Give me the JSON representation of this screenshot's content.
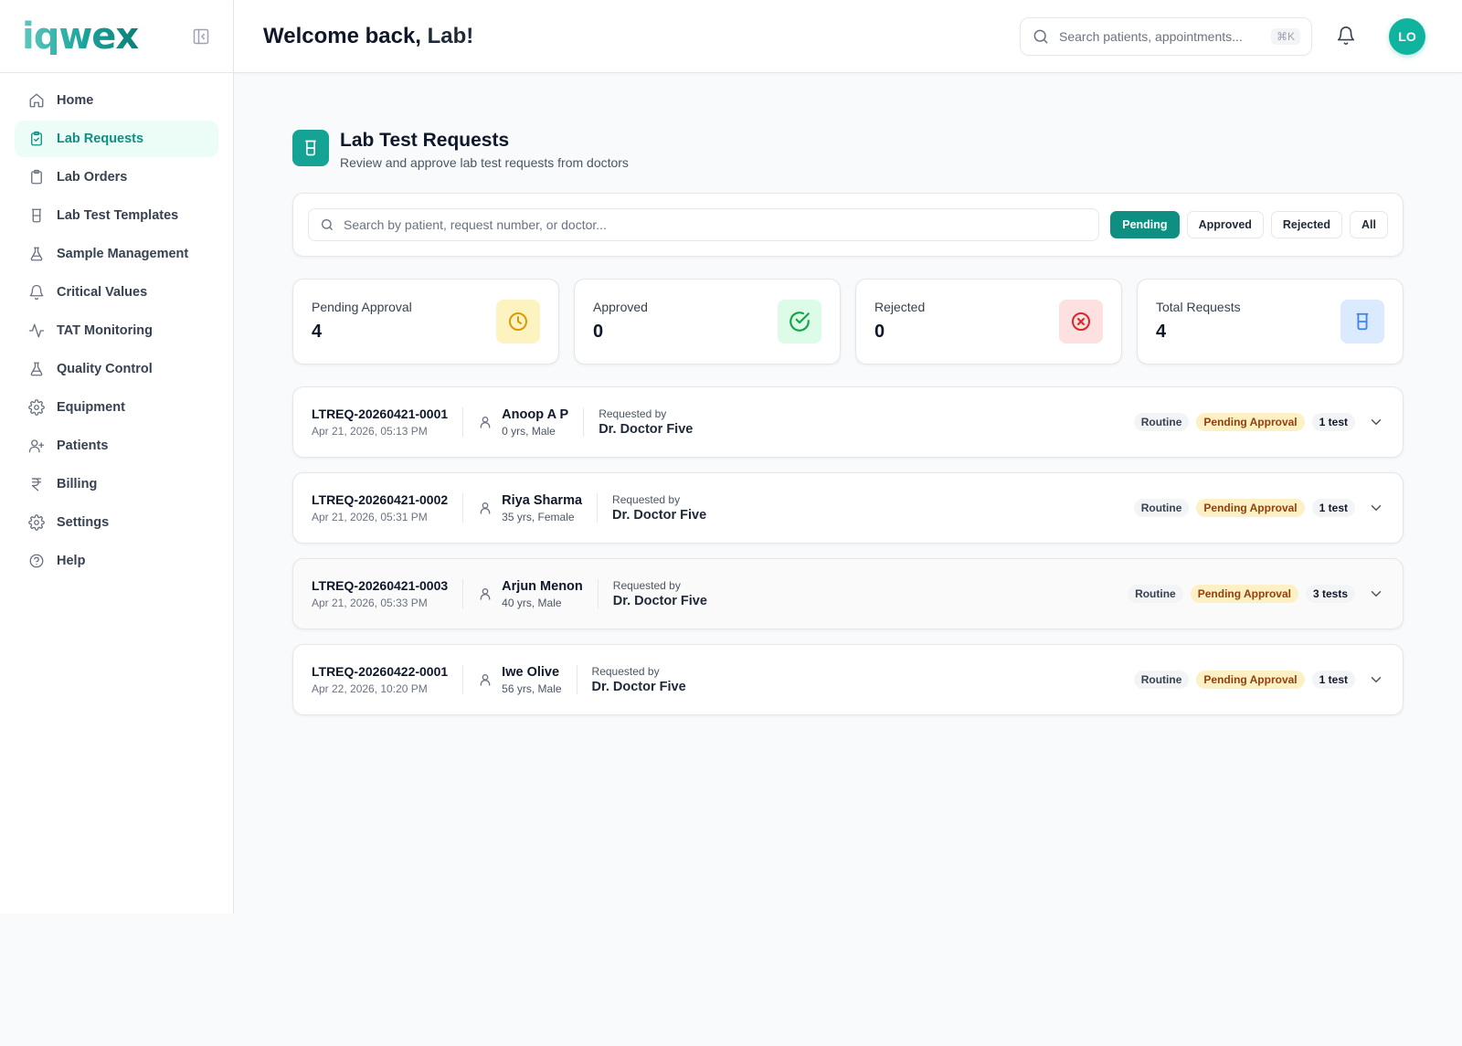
{
  "brand": {
    "logo_text": "iqwex"
  },
  "sidebar": {
    "items": [
      {
        "label": "Home",
        "icon": "home-icon"
      },
      {
        "label": "Lab Requests",
        "icon": "clipboard-check-icon",
        "active": true
      },
      {
        "label": "Lab Orders",
        "icon": "clipboard-icon"
      },
      {
        "label": "Lab Test Templates",
        "icon": "beaker-icon"
      },
      {
        "label": "Sample Management",
        "icon": "flask-icon"
      },
      {
        "label": "Critical Values",
        "icon": "bell-icon"
      },
      {
        "label": "TAT Monitoring",
        "icon": "activity-icon"
      },
      {
        "label": "Quality Control",
        "icon": "flask-icon"
      },
      {
        "label": "Equipment",
        "icon": "gear-icon"
      },
      {
        "label": "Patients",
        "icon": "user-plus-icon"
      },
      {
        "label": "Billing",
        "icon": "rupee-icon"
      },
      {
        "label": "Settings",
        "icon": "gear-icon"
      },
      {
        "label": "Help",
        "icon": "help-circle-icon"
      }
    ]
  },
  "header": {
    "welcome_prefix": "Welcome back,",
    "welcome_name": "Lab!",
    "search_placeholder": "Search patients, appointments...",
    "search_shortcut": "⌘K",
    "avatar_initials": "LO"
  },
  "page": {
    "title": "Lab Test Requests",
    "subtitle": "Review and approve lab test requests from doctors"
  },
  "filters": {
    "search_placeholder": "Search by patient, request number, or doctor...",
    "tabs": [
      {
        "label": "Pending",
        "active": true
      },
      {
        "label": "Approved"
      },
      {
        "label": "Rejected"
      },
      {
        "label": "All"
      }
    ]
  },
  "stats": [
    {
      "label": "Pending Approval",
      "value": "4",
      "icon": "clock-icon",
      "bg": "#fdf3c0",
      "fg": "#d99a06"
    },
    {
      "label": "Approved",
      "value": "0",
      "icon": "check-circle-icon",
      "bg": "#dcfce7",
      "fg": "#16a34a"
    },
    {
      "label": "Rejected",
      "value": "0",
      "icon": "x-circle-icon",
      "bg": "#fde0e0",
      "fg": "#dc2626"
    },
    {
      "label": "Total Requests",
      "value": "4",
      "icon": "beaker-icon",
      "bg": "#dbeafe",
      "fg": "#3b82f6"
    }
  ],
  "requests": [
    {
      "id": "LTREQ-20260421-0001",
      "date": "Apr 21, 2026, 05:13 PM",
      "patient": "Anoop A P",
      "meta": "0 yrs, Male",
      "requested_by_label": "Requested by",
      "doctor": "Dr. Doctor Five",
      "priority": "Routine",
      "status": "Pending Approval",
      "count": "1 test"
    },
    {
      "id": "LTREQ-20260421-0002",
      "date": "Apr 21, 2026, 05:31 PM",
      "patient": "Riya Sharma",
      "meta": "35 yrs, Female",
      "requested_by_label": "Requested by",
      "doctor": "Dr. Doctor Five",
      "priority": "Routine",
      "status": "Pending Approval",
      "count": "1 test"
    },
    {
      "id": "LTREQ-20260421-0003",
      "date": "Apr 21, 2026, 05:33 PM",
      "patient": "Arjun Menon",
      "meta": "40 yrs, Male",
      "requested_by_label": "Requested by",
      "doctor": "Dr. Doctor Five",
      "priority": "Routine",
      "status": "Pending Approval",
      "count": "3 tests"
    },
    {
      "id": "LTREQ-20260422-0001",
      "date": "Apr 22, 2026, 10:20 PM",
      "patient": "Iwe Olive",
      "meta": "56 yrs, Male",
      "requested_by_label": "Requested by",
      "doctor": "Dr. Doctor Five",
      "priority": "Routine",
      "status": "Pending Approval",
      "count": "1 test"
    }
  ]
}
